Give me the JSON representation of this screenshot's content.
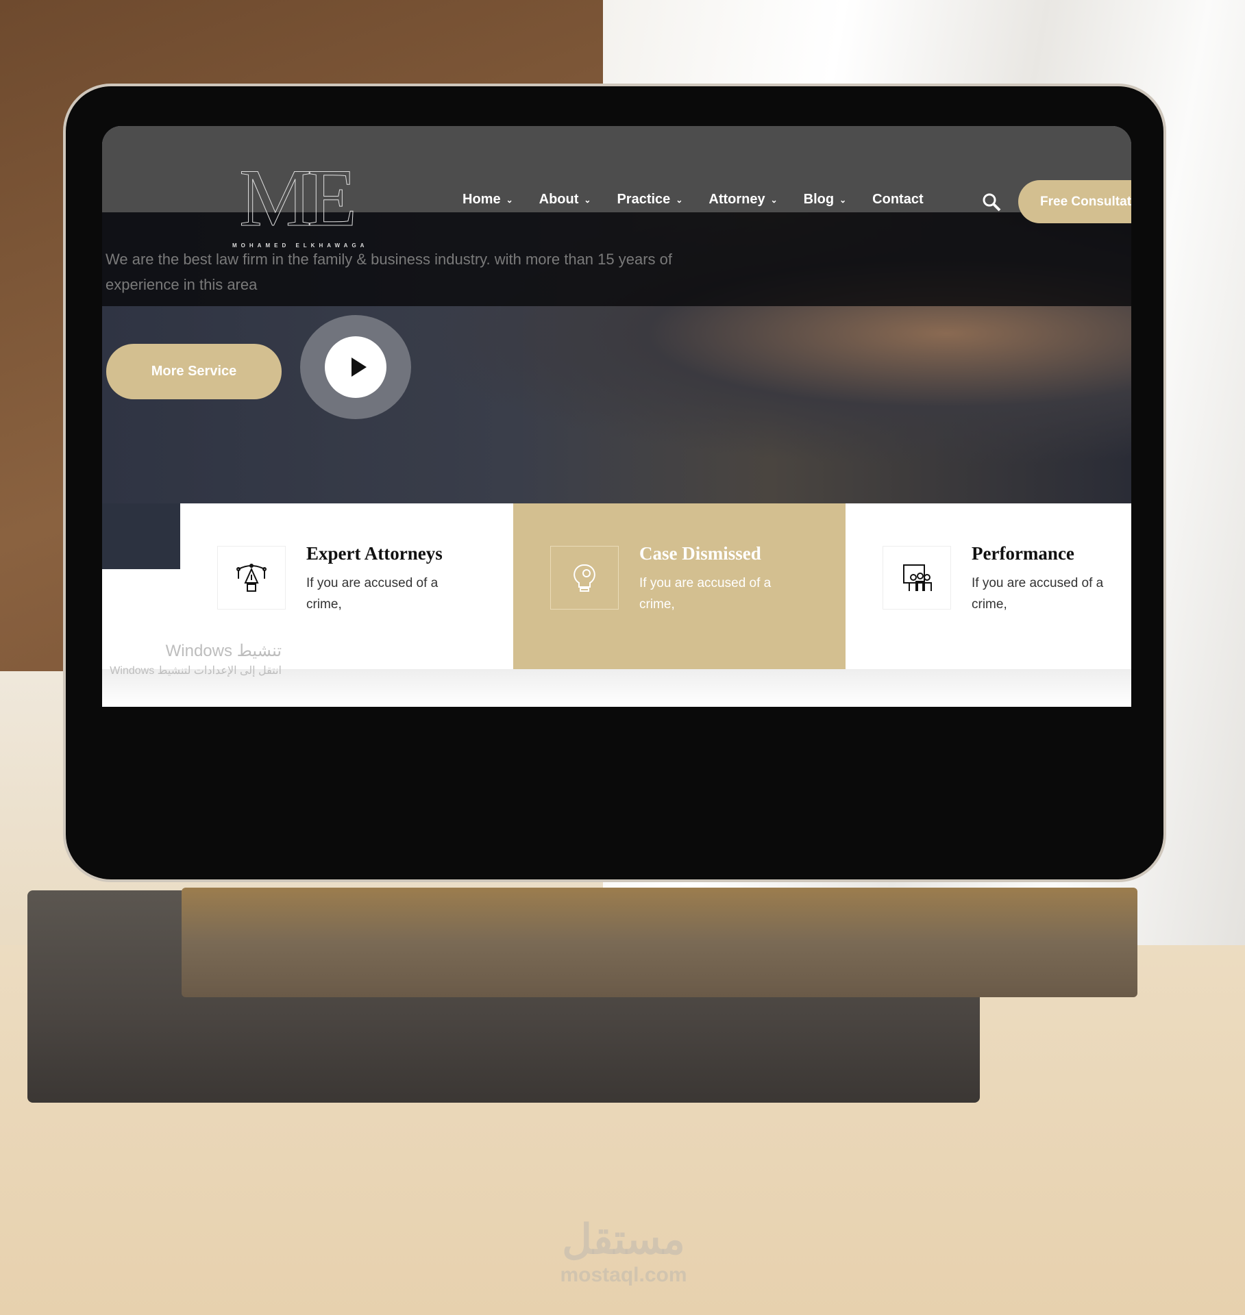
{
  "logo": {
    "mark": "ME",
    "subtitle": "MOHAMED ELKHAWAGA"
  },
  "nav": {
    "items": [
      {
        "label": "Home",
        "has_dropdown": true
      },
      {
        "label": "About",
        "has_dropdown": true
      },
      {
        "label": "Practice",
        "has_dropdown": true
      },
      {
        "label": "Attorney",
        "has_dropdown": true
      },
      {
        "label": "Blog",
        "has_dropdown": true
      },
      {
        "label": "Contact",
        "has_dropdown": false
      }
    ],
    "search_icon": "search-icon",
    "cta_label": "Free Consultation"
  },
  "hero": {
    "tagline": "We are the best law firm in the family & business industry. with more than 15 years of experience in this area",
    "more_label": "More Service",
    "play_icon": "play-icon"
  },
  "cards": [
    {
      "title": "Expert Attorneys",
      "body": "If you are accused of a crime,",
      "icon": "pen-tool-icon"
    },
    {
      "title": "Case Dismissed",
      "body": "If you are accused of a crime,",
      "icon": "lightbulb-gear-icon"
    },
    {
      "title": "Performance",
      "body": "If you are accused of a crime,",
      "icon": "team-icon"
    }
  ],
  "windows_watermark": {
    "line1": "تنشيط Windows",
    "line2": "انتقل إلى الإعدادات لتنشيط Windows"
  },
  "mostaql": {
    "ar": "مستقل",
    "en": "mostaql.com"
  },
  "colors": {
    "accent": "#d3bf90",
    "navbar": "#4d4d4d",
    "dark": "#2c3240"
  }
}
